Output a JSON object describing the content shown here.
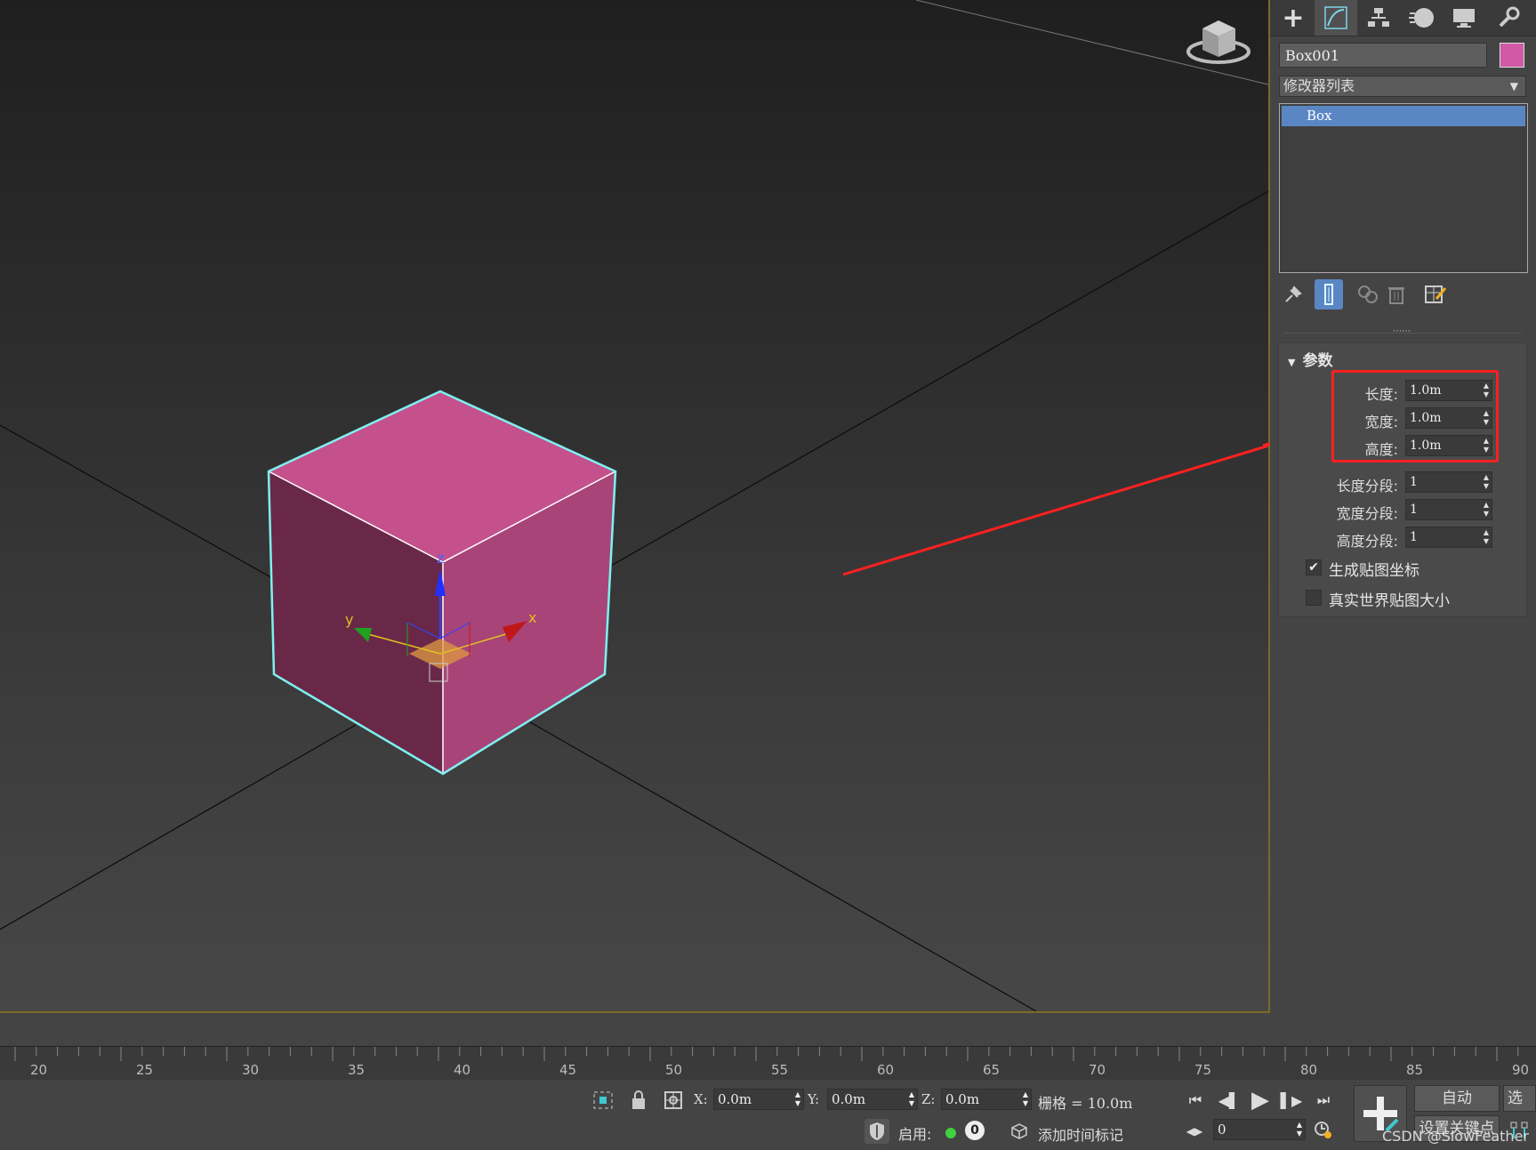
{
  "command_panel": {
    "tabs": [
      "create-tab",
      "modify-tab",
      "hierarchy-tab",
      "motion-tab",
      "display-tab",
      "utilities-tab"
    ],
    "object_name": "Box001",
    "object_color": "#d15aa6",
    "modifier_list_label": "修改器列表",
    "stack_items": [
      "Box"
    ],
    "rollout_title": "参数",
    "params": [
      {
        "label": "长度:",
        "value": "1.0m"
      },
      {
        "label": "宽度:",
        "value": "1.0m"
      },
      {
        "label": "高度:",
        "value": "1.0m"
      },
      {
        "label": "长度分段:",
        "value": "1"
      },
      {
        "label": "宽度分段:",
        "value": "1"
      },
      {
        "label": "高度分段:",
        "value": "1"
      }
    ],
    "checks": [
      {
        "label": "生成贴图坐标",
        "checked": true
      },
      {
        "label": "真实世界贴图大小",
        "checked": false
      }
    ]
  },
  "viewport": {
    "gizmo_axes": [
      "x",
      "y",
      "z"
    ],
    "box_color": "#c4508c",
    "selection_color": "#7ff0f0",
    "annotation_color": "#ff2020"
  },
  "timeline": {
    "ticks": [
      "20",
      "25",
      "30",
      "35",
      "40",
      "45",
      "50",
      "55",
      "60",
      "65",
      "70",
      "75",
      "80",
      "85",
      "90"
    ]
  },
  "status": {
    "x_label": "X:",
    "x_value": "0.0m",
    "y_label": "Y:",
    "y_value": "0.0m",
    "z_label": "Z:",
    "z_value": "0.0m",
    "grid_text": "栅格 = 10.0m",
    "enable_label": "启用:",
    "enable_count": "0",
    "add_time_tag": "添加时间标记",
    "auto_key": "自动",
    "set_key": "设置关键点",
    "selected_label": "选定",
    "frame_value": "0"
  },
  "watermark": "CSDN @SlowFeather"
}
